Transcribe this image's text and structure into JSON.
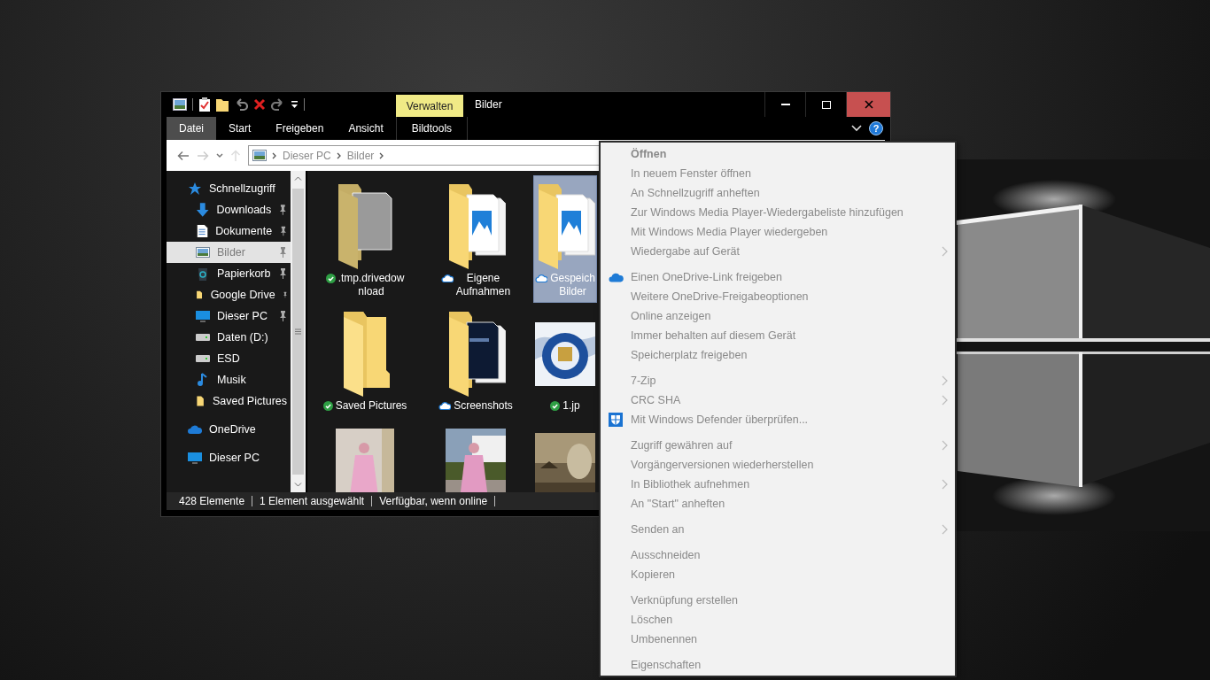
{
  "window": {
    "title": "Bilder",
    "context_tab": "Verwalten"
  },
  "ribbon": {
    "tabs": [
      {
        "label": "Datei",
        "selected": true
      },
      {
        "label": "Start",
        "selected": false
      },
      {
        "label": "Freigeben",
        "selected": false
      },
      {
        "label": "Ansicht",
        "selected": false
      },
      {
        "label": "Bildtools",
        "selected": false
      }
    ],
    "help": "?"
  },
  "address": {
    "path": [
      "Dieser PC",
      "Bilder"
    ]
  },
  "sidebar": {
    "items": [
      {
        "label": "Schnellzugriff",
        "kind": "star",
        "selected": false,
        "children": [
          {
            "label": "Downloads",
            "kind": "download",
            "pinned": true,
            "selected": false
          },
          {
            "label": "Dokumente",
            "kind": "document",
            "pinned": true,
            "selected": false
          },
          {
            "label": "Bilder",
            "kind": "pictures",
            "pinned": true,
            "selected": true
          },
          {
            "label": "Papierkorb",
            "kind": "recycle",
            "pinned": true,
            "selected": false
          },
          {
            "label": "Google Drive",
            "kind": "folder",
            "pinned": true,
            "selected": false
          },
          {
            "label": "Dieser PC",
            "kind": "monitor",
            "pinned": true,
            "selected": false
          },
          {
            "label": "Daten (D:)",
            "kind": "drive",
            "pinned": false,
            "selected": false
          },
          {
            "label": "ESD",
            "kind": "drive",
            "pinned": false,
            "selected": false
          },
          {
            "label": "Musik",
            "kind": "music",
            "pinned": false,
            "selected": false
          },
          {
            "label": "Saved Pictures",
            "kind": "folder",
            "pinned": false,
            "selected": false
          }
        ]
      },
      {
        "label": "OneDrive",
        "kind": "cloud",
        "selected": false
      },
      {
        "label": "Dieser PC",
        "kind": "monitor",
        "selected": false
      }
    ]
  },
  "files": {
    "items": [
      {
        "kind": "folder-document",
        "lines": [
          ".tmp.drivedow",
          "nload"
        ],
        "available_offline": true,
        "selected": false
      },
      {
        "kind": "folder-pictures",
        "lines": [
          "Eigene",
          "Aufnahmen"
        ],
        "available_offline": false,
        "selected": false
      },
      {
        "kind": "folder-pictures",
        "lines": [
          "Gespeich",
          "Bilder"
        ],
        "available_offline": false,
        "selected": true
      },
      {
        "kind": "folder",
        "lines": [
          "Saved Pictures"
        ],
        "available_offline": true,
        "selected": false
      },
      {
        "kind": "folder-screenshots",
        "lines": [
          "Screenshots"
        ],
        "available_offline": false,
        "selected": false
      },
      {
        "kind": "picture",
        "lines": [
          "1.jp"
        ],
        "available_offline": true,
        "selected": false
      },
      {
        "kind": "picture",
        "selected": false
      },
      {
        "kind": "picture",
        "selected": false
      },
      {
        "kind": "picture",
        "selected": false
      }
    ]
  },
  "status_bar": [
    "428 Elemente",
    "1 Element ausgewählt",
    "Verfügbar, wenn online"
  ],
  "context_menu": {
    "groups": [
      [
        {
          "label": "Öffnen",
          "default": true,
          "submenu": false
        },
        {
          "label": "In neuem Fenster öffnen",
          "default": false,
          "submenu": false
        },
        {
          "label": "An Schnellzugriff anheften",
          "default": false,
          "submenu": false
        },
        {
          "label": "Zur Windows Media Player-Wiedergabeliste hinzufügen",
          "default": false,
          "submenu": false
        },
        {
          "label": "Mit Windows Media Player wiedergeben",
          "default": false,
          "submenu": false
        },
        {
          "label": "Wiedergabe auf Gerät",
          "default": false,
          "submenu": true
        }
      ],
      [
        {
          "label": "Einen OneDrive-Link freigeben",
          "default": false,
          "submenu": false
        },
        {
          "label": "Weitere OneDrive-Freigabeoptionen",
          "default": false,
          "submenu": false
        },
        {
          "label": "Online anzeigen",
          "default": false,
          "submenu": false
        },
        {
          "label": "Immer behalten auf diesem Gerät",
          "default": false,
          "submenu": false
        },
        {
          "label": "Speicherplatz freigeben",
          "default": false,
          "submenu": false
        }
      ],
      [
        {
          "label": "7-Zip",
          "default": false,
          "submenu": true
        },
        {
          "label": "CRC SHA",
          "default": false,
          "submenu": true
        },
        {
          "label": "Mit Windows Defender überprüfen...",
          "default": false,
          "submenu": false
        }
      ],
      [
        {
          "label": "Zugriff gewähren auf",
          "default": false,
          "submenu": true
        },
        {
          "label": "Vorgängerversionen wiederherstellen",
          "default": false,
          "submenu": false
        },
        {
          "label": "In Bibliothek aufnehmen",
          "default": false,
          "submenu": true
        },
        {
          "label": "An \"Start\" anheften",
          "default": false,
          "submenu": false
        }
      ],
      [
        {
          "label": "Senden an",
          "default": false,
          "submenu": true
        }
      ],
      [
        {
          "label": "Ausschneiden",
          "default": false,
          "submenu": false
        },
        {
          "label": "Kopieren",
          "default": false,
          "submenu": false
        }
      ],
      [
        {
          "label": "Verknüpfung erstellen",
          "default": false,
          "submenu": false
        },
        {
          "label": "Löschen",
          "default": false,
          "submenu": false
        },
        {
          "label": "Umbenennen",
          "default": false,
          "submenu": false
        }
      ],
      [
        {
          "label": "Eigenschaften",
          "default": false,
          "submenu": false
        }
      ]
    ]
  }
}
